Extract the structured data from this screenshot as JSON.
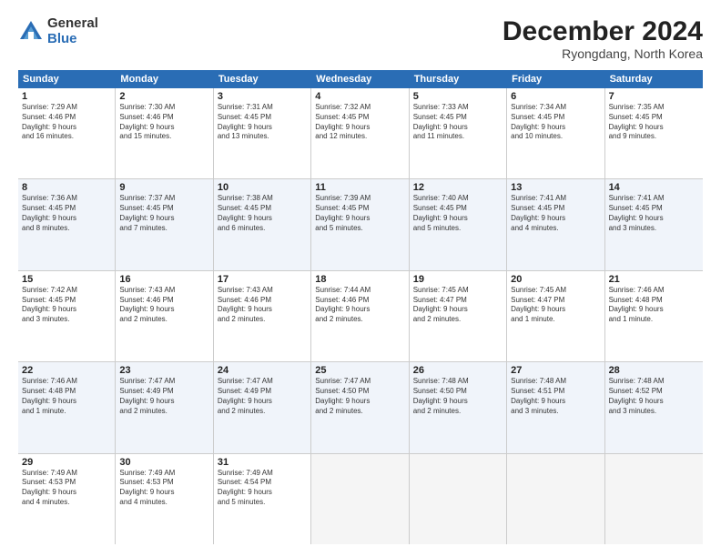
{
  "logo": {
    "general": "General",
    "blue": "Blue"
  },
  "title": "December 2024",
  "location": "Ryongdang, North Korea",
  "days": [
    "Sunday",
    "Monday",
    "Tuesday",
    "Wednesday",
    "Thursday",
    "Friday",
    "Saturday"
  ],
  "rows": [
    [
      {
        "day": "1",
        "lines": [
          "Sunrise: 7:29 AM",
          "Sunset: 4:46 PM",
          "Daylight: 9 hours",
          "and 16 minutes."
        ]
      },
      {
        "day": "2",
        "lines": [
          "Sunrise: 7:30 AM",
          "Sunset: 4:46 PM",
          "Daylight: 9 hours",
          "and 15 minutes."
        ]
      },
      {
        "day": "3",
        "lines": [
          "Sunrise: 7:31 AM",
          "Sunset: 4:45 PM",
          "Daylight: 9 hours",
          "and 13 minutes."
        ]
      },
      {
        "day": "4",
        "lines": [
          "Sunrise: 7:32 AM",
          "Sunset: 4:45 PM",
          "Daylight: 9 hours",
          "and 12 minutes."
        ]
      },
      {
        "day": "5",
        "lines": [
          "Sunrise: 7:33 AM",
          "Sunset: 4:45 PM",
          "Daylight: 9 hours",
          "and 11 minutes."
        ]
      },
      {
        "day": "6",
        "lines": [
          "Sunrise: 7:34 AM",
          "Sunset: 4:45 PM",
          "Daylight: 9 hours",
          "and 10 minutes."
        ]
      },
      {
        "day": "7",
        "lines": [
          "Sunrise: 7:35 AM",
          "Sunset: 4:45 PM",
          "Daylight: 9 hours",
          "and 9 minutes."
        ]
      }
    ],
    [
      {
        "day": "8",
        "lines": [
          "Sunrise: 7:36 AM",
          "Sunset: 4:45 PM",
          "Daylight: 9 hours",
          "and 8 minutes."
        ]
      },
      {
        "day": "9",
        "lines": [
          "Sunrise: 7:37 AM",
          "Sunset: 4:45 PM",
          "Daylight: 9 hours",
          "and 7 minutes."
        ]
      },
      {
        "day": "10",
        "lines": [
          "Sunrise: 7:38 AM",
          "Sunset: 4:45 PM",
          "Daylight: 9 hours",
          "and 6 minutes."
        ]
      },
      {
        "day": "11",
        "lines": [
          "Sunrise: 7:39 AM",
          "Sunset: 4:45 PM",
          "Daylight: 9 hours",
          "and 5 minutes."
        ]
      },
      {
        "day": "12",
        "lines": [
          "Sunrise: 7:40 AM",
          "Sunset: 4:45 PM",
          "Daylight: 9 hours",
          "and 5 minutes."
        ]
      },
      {
        "day": "13",
        "lines": [
          "Sunrise: 7:41 AM",
          "Sunset: 4:45 PM",
          "Daylight: 9 hours",
          "and 4 minutes."
        ]
      },
      {
        "day": "14",
        "lines": [
          "Sunrise: 7:41 AM",
          "Sunset: 4:45 PM",
          "Daylight: 9 hours",
          "and 3 minutes."
        ]
      }
    ],
    [
      {
        "day": "15",
        "lines": [
          "Sunrise: 7:42 AM",
          "Sunset: 4:45 PM",
          "Daylight: 9 hours",
          "and 3 minutes."
        ]
      },
      {
        "day": "16",
        "lines": [
          "Sunrise: 7:43 AM",
          "Sunset: 4:46 PM",
          "Daylight: 9 hours",
          "and 2 minutes."
        ]
      },
      {
        "day": "17",
        "lines": [
          "Sunrise: 7:43 AM",
          "Sunset: 4:46 PM",
          "Daylight: 9 hours",
          "and 2 minutes."
        ]
      },
      {
        "day": "18",
        "lines": [
          "Sunrise: 7:44 AM",
          "Sunset: 4:46 PM",
          "Daylight: 9 hours",
          "and 2 minutes."
        ]
      },
      {
        "day": "19",
        "lines": [
          "Sunrise: 7:45 AM",
          "Sunset: 4:47 PM",
          "Daylight: 9 hours",
          "and 2 minutes."
        ]
      },
      {
        "day": "20",
        "lines": [
          "Sunrise: 7:45 AM",
          "Sunset: 4:47 PM",
          "Daylight: 9 hours",
          "and 1 minute."
        ]
      },
      {
        "day": "21",
        "lines": [
          "Sunrise: 7:46 AM",
          "Sunset: 4:48 PM",
          "Daylight: 9 hours",
          "and 1 minute."
        ]
      }
    ],
    [
      {
        "day": "22",
        "lines": [
          "Sunrise: 7:46 AM",
          "Sunset: 4:48 PM",
          "Daylight: 9 hours",
          "and 1 minute."
        ]
      },
      {
        "day": "23",
        "lines": [
          "Sunrise: 7:47 AM",
          "Sunset: 4:49 PM",
          "Daylight: 9 hours",
          "and 2 minutes."
        ]
      },
      {
        "day": "24",
        "lines": [
          "Sunrise: 7:47 AM",
          "Sunset: 4:49 PM",
          "Daylight: 9 hours",
          "and 2 minutes."
        ]
      },
      {
        "day": "25",
        "lines": [
          "Sunrise: 7:47 AM",
          "Sunset: 4:50 PM",
          "Daylight: 9 hours",
          "and 2 minutes."
        ]
      },
      {
        "day": "26",
        "lines": [
          "Sunrise: 7:48 AM",
          "Sunset: 4:50 PM",
          "Daylight: 9 hours",
          "and 2 minutes."
        ]
      },
      {
        "day": "27",
        "lines": [
          "Sunrise: 7:48 AM",
          "Sunset: 4:51 PM",
          "Daylight: 9 hours",
          "and 3 minutes."
        ]
      },
      {
        "day": "28",
        "lines": [
          "Sunrise: 7:48 AM",
          "Sunset: 4:52 PM",
          "Daylight: 9 hours",
          "and 3 minutes."
        ]
      }
    ],
    [
      {
        "day": "29",
        "lines": [
          "Sunrise: 7:49 AM",
          "Sunset: 4:53 PM",
          "Daylight: 9 hours",
          "and 4 minutes."
        ]
      },
      {
        "day": "30",
        "lines": [
          "Sunrise: 7:49 AM",
          "Sunset: 4:53 PM",
          "Daylight: 9 hours",
          "and 4 minutes."
        ]
      },
      {
        "day": "31",
        "lines": [
          "Sunrise: 7:49 AM",
          "Sunset: 4:54 PM",
          "Daylight: 9 hours",
          "and 5 minutes."
        ]
      },
      null,
      null,
      null,
      null
    ]
  ]
}
